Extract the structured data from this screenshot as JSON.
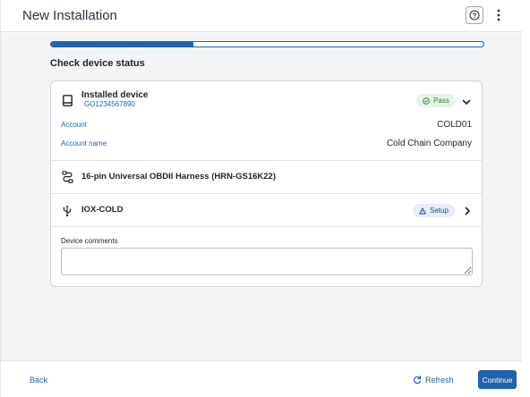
{
  "header": {
    "title": "New Installation",
    "help_icon": "question-circle-icon",
    "more_icon": "more-vertical-icon"
  },
  "progress": {
    "fraction": 0.33
  },
  "section_title": "Check device status",
  "device": {
    "label": "Installed device",
    "serial": "GO1234567890",
    "status": "Pass",
    "icon": "device-icon",
    "account_label": "Account",
    "account_value": "COLD01",
    "account_name_label": "Account name",
    "account_name_value": "Cold Chain Company"
  },
  "harness": {
    "label": "16-pin Universal OBDII Harness (HRN-GS16K22)",
    "icon": "harness-cable-icon"
  },
  "iox": {
    "label": "IOX-COLD",
    "status": "Setup",
    "icon": "usb-icon"
  },
  "comments": {
    "label": "Device comments",
    "value": "",
    "placeholder": ""
  },
  "footer": {
    "back_label": "Back",
    "refresh_label": "Refresh",
    "continue_label": "Continue"
  },
  "colors": {
    "accent": "#1e63ad",
    "pass_bg": "#e5f4e9",
    "pass_text": "#2e7d32",
    "setup_bg": "#e7eef7"
  }
}
